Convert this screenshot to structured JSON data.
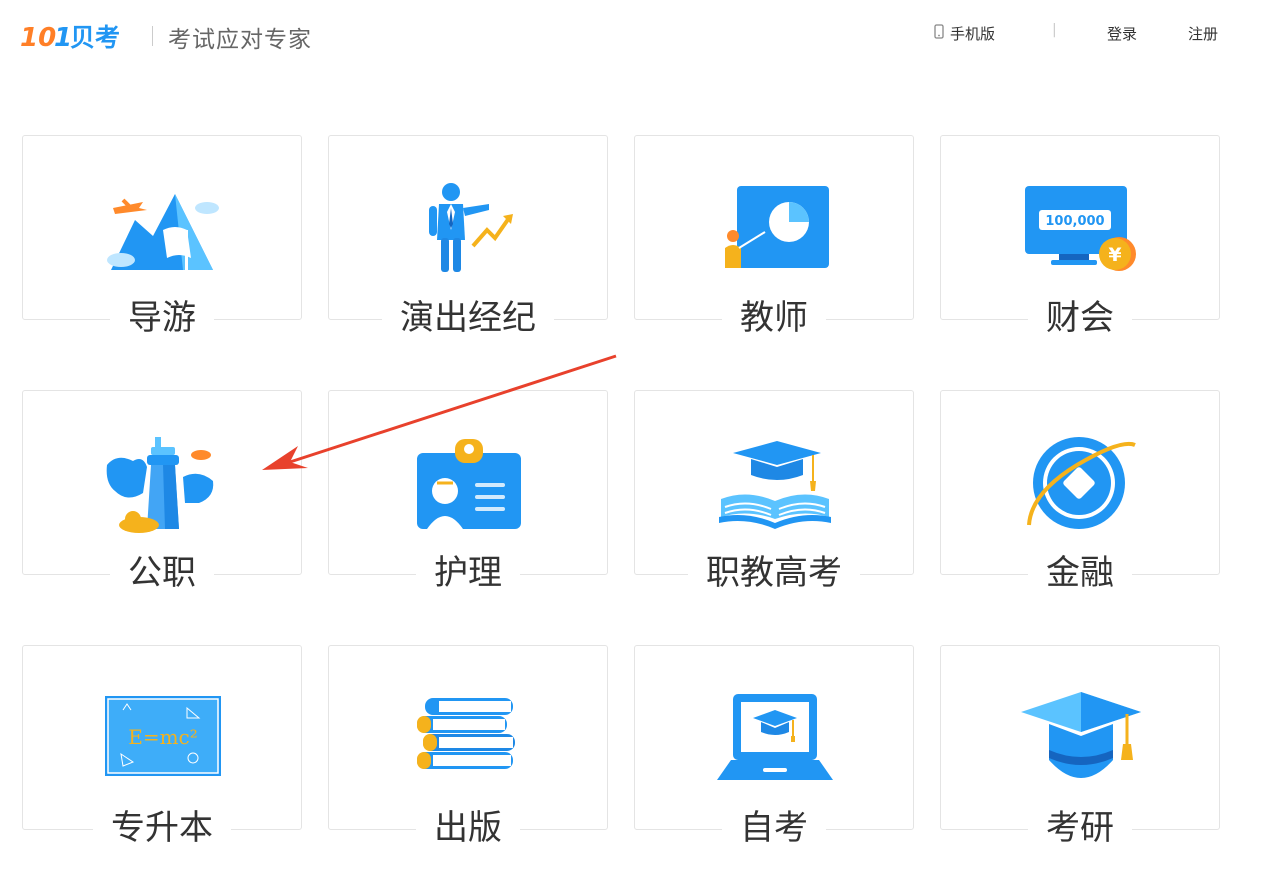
{
  "header": {
    "logo_text": "101贝考",
    "slogan": "考试应对专家",
    "mobile_label": "手机版",
    "separator": "|",
    "login_label": "登录",
    "register_label": "注册"
  },
  "categories": [
    {
      "label": "导游",
      "icon": "mountain-flag-icon"
    },
    {
      "label": "演出经纪",
      "icon": "presenter-chart-icon"
    },
    {
      "label": "教师",
      "icon": "teacher-board-icon"
    },
    {
      "label": "财会",
      "icon": "monitor-money-icon",
      "icon_text": "100,000",
      "coin_text": "¥"
    },
    {
      "label": "公职",
      "icon": "tower-clouds-icon"
    },
    {
      "label": "护理",
      "icon": "nurse-badge-icon"
    },
    {
      "label": "职教高考",
      "icon": "book-cap-icon"
    },
    {
      "label": "金融",
      "icon": "orbit-coin-icon"
    },
    {
      "label": "专升本",
      "icon": "formula-board-icon",
      "icon_text": "E=mc²"
    },
    {
      "label": "出版",
      "icon": "book-stack-icon"
    },
    {
      "label": "自考",
      "icon": "laptop-cap-icon"
    },
    {
      "label": "考研",
      "icon": "graduation-cap-icon"
    }
  ],
  "colors": {
    "primary_blue": "#2196f3",
    "light_blue": "#5bc3ff",
    "accent_orange": "#ff8a2b",
    "accent_yellow": "#f5b21c",
    "arrow_red": "#e8412c"
  }
}
